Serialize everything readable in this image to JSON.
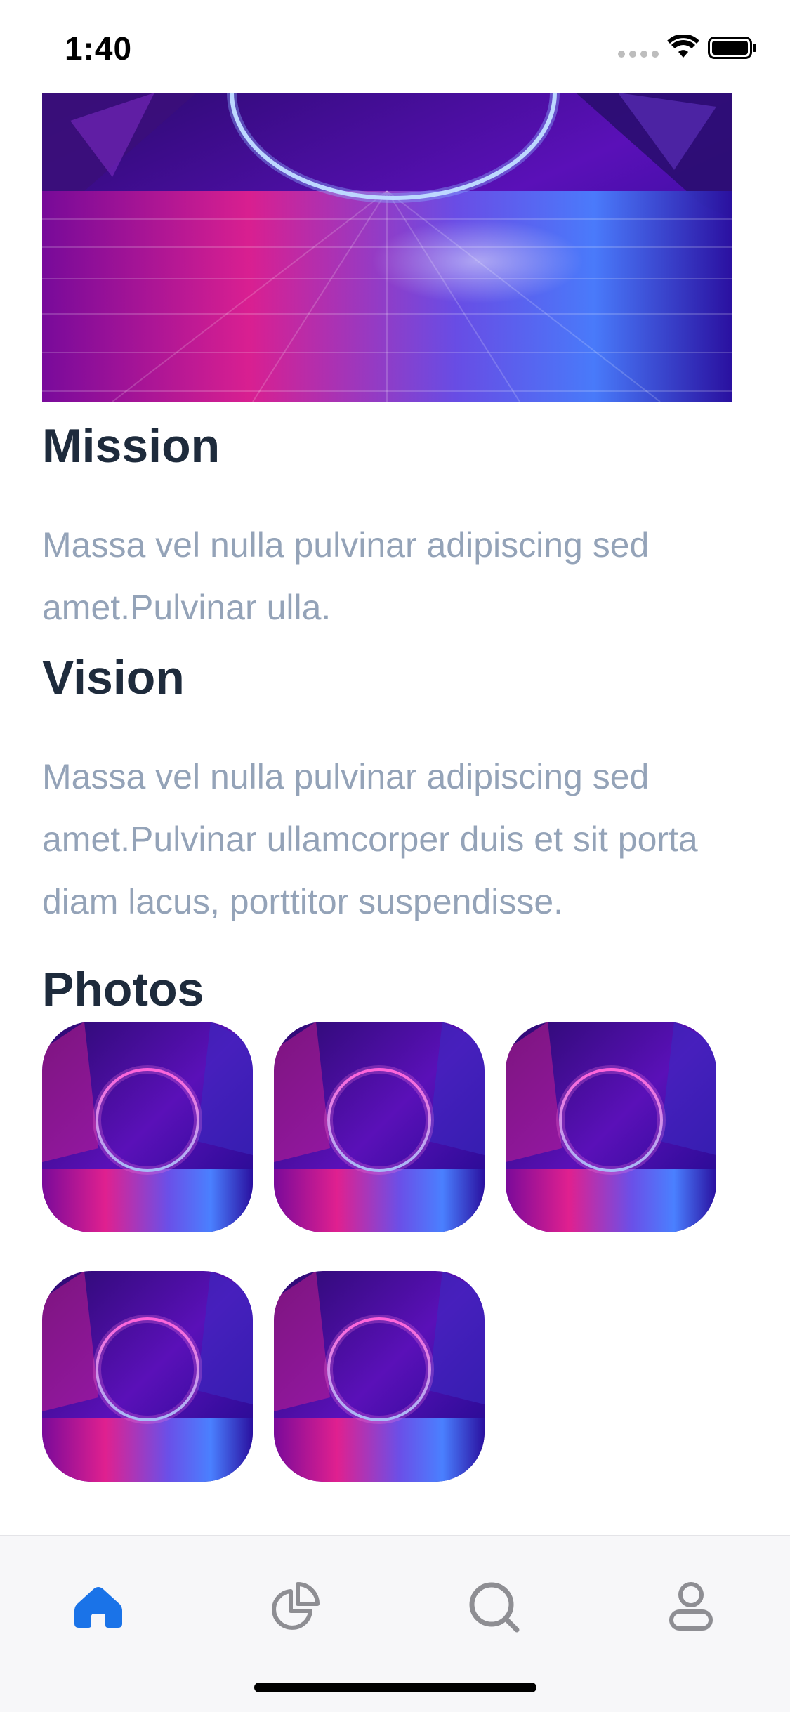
{
  "status_bar": {
    "time": "1:40"
  },
  "sections": {
    "mission": {
      "title": "Mission",
      "body": "Massa vel nulla pulvinar adipiscing sed amet.Pulvinar ulla."
    },
    "vision": {
      "title": "Vision",
      "body": "Massa vel nulla pulvinar adipiscing sed amet.Pulvinar ullamcorper duis et sit porta diam lacus, porttitor suspendisse."
    },
    "photos": {
      "title": "Photos",
      "count": 5
    }
  },
  "tab_bar": {
    "items": [
      {
        "icon": "home-icon",
        "active": true
      },
      {
        "icon": "pie-chart-icon",
        "active": false
      },
      {
        "icon": "search-icon",
        "active": false
      },
      {
        "icon": "profile-icon",
        "active": false
      }
    ],
    "active_color": "#1a73e8",
    "inactive_color": "#8e8e93"
  },
  "colors": {
    "title": "#1e2b3c",
    "body_text": "#94a3b8"
  }
}
